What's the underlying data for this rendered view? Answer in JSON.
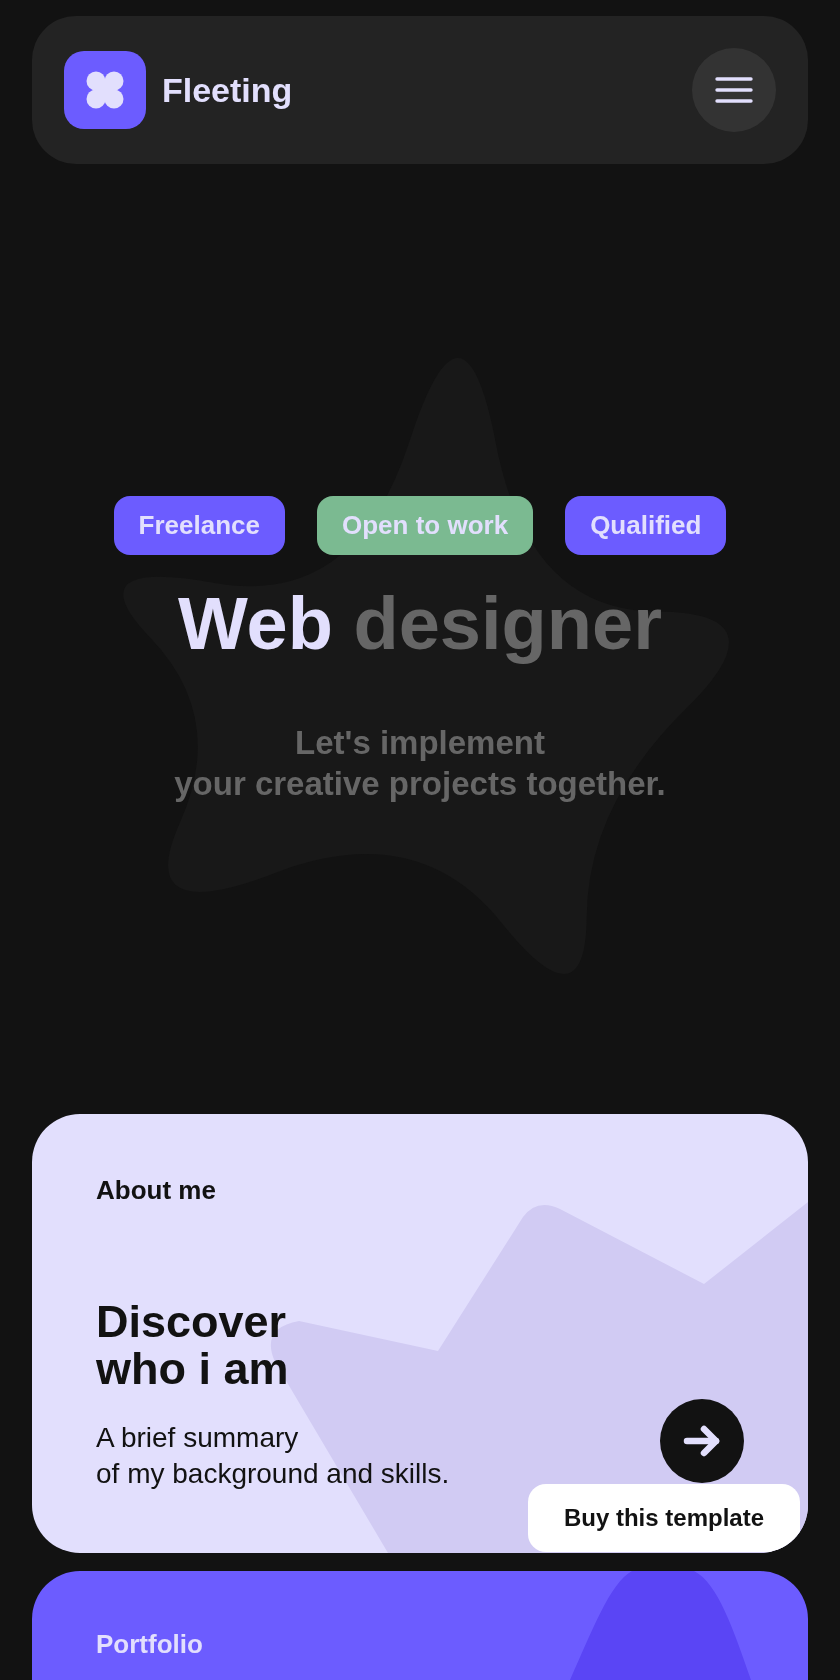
{
  "header": {
    "brand": "Fleeting"
  },
  "hero": {
    "tags": [
      {
        "label": "Freelance",
        "color": "#6c5cff"
      },
      {
        "label": "Open to work",
        "color": "#7bba91"
      },
      {
        "label": "Qualified",
        "color": "#6c5cff"
      }
    ],
    "title": {
      "lead": "Web",
      "rest": "designer"
    },
    "subtitle": "Let's implement\nyour creative projects together."
  },
  "about_card": {
    "label": "About me",
    "heading": "Discover\nwho i am",
    "summary": "A brief summary\nof my background and skills."
  },
  "buy_button": "Buy this template",
  "portfolio_card": {
    "label": "Portfolio"
  }
}
